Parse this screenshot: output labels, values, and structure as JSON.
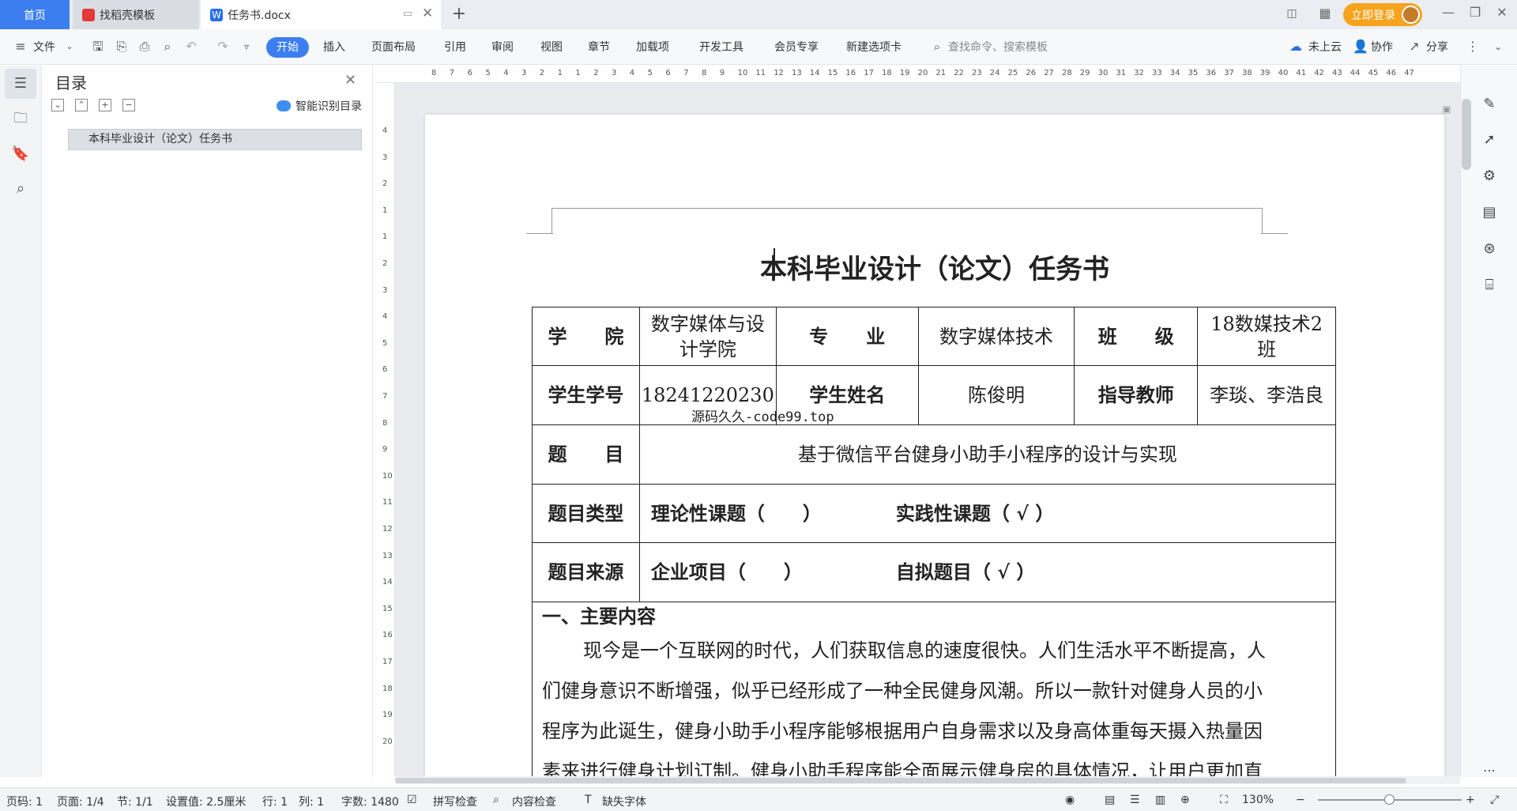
{
  "tabs": [
    {
      "label": "首页"
    },
    {
      "label": "找稻壳模板"
    },
    {
      "label": "任务书.docx"
    }
  ],
  "account": {
    "login_label": "立即登录"
  },
  "toolbar": {
    "file_label": "文件",
    "ribbon": [
      "开始",
      "插入",
      "页面布局",
      "引用",
      "审阅",
      "视图",
      "章节",
      "加载项",
      "开发工具",
      "会员专享",
      "新建选项卡"
    ],
    "search_placeholder": "查找命令、搜索模板",
    "cloud_label": "未上云",
    "collab_label": "协作",
    "share_label": "分享"
  },
  "toc": {
    "title": "目录",
    "ai_label": "智能识别目录",
    "items": [
      {
        "label": "本科毕业设计（论文）任务书"
      }
    ]
  },
  "ruler": {
    "h_ticks": [
      "8",
      "7",
      "6",
      "5",
      "4",
      "3",
      "2",
      "1",
      "1",
      "2",
      "3",
      "4",
      "5",
      "6",
      "7",
      "8",
      "9",
      "10",
      "11",
      "12",
      "13",
      "14",
      "15",
      "16",
      "17",
      "18",
      "19",
      "20",
      "21",
      "22",
      "23",
      "24",
      "25",
      "26",
      "27",
      "28",
      "29",
      "30",
      "31",
      "32",
      "33",
      "34",
      "35",
      "36",
      "37",
      "38",
      "39",
      "40",
      "41",
      "42",
      "43",
      "44",
      "45",
      "46",
      "47"
    ],
    "v_ticks": [
      "4",
      "3",
      "2",
      "1",
      "1",
      "2",
      "3",
      "4",
      "5",
      "6",
      "7",
      "8",
      "9",
      "10",
      "11",
      "12",
      "13",
      "14",
      "15",
      "16",
      "17",
      "18",
      "19",
      "20"
    ]
  },
  "document": {
    "title": "本科毕业设计（论文）任务书",
    "row1": {
      "college_label": "学　　院",
      "college_value": "数字媒体与设计学院",
      "major_label": "专　　业",
      "major_value": "数字媒体技术",
      "class_label": "班　　级",
      "class_value": "18数媒技术2班"
    },
    "row2": {
      "sid_label": "学生学号",
      "sid_value": "18241220230",
      "name_label": "学生姓名",
      "name_value": "陈俊明",
      "teacher_label": "指导教师",
      "teacher_value": "李琰、李浩良"
    },
    "topic_label": "题　　目",
    "topic_value": "基于微信平台健身小助手小程序的设计与实现",
    "type_label": "题目类型",
    "type_theory": "理论性课题（　　）",
    "type_practice": "实践性课题（ √ ）",
    "source_label": "题目来源",
    "source_enterprise": "企业项目（　　）",
    "source_self": "自拟题目（ √ ）",
    "section_heading": "一、主要内容",
    "paragraph_lines": [
      "现今是一个互联网的时代，人们获取信息的速度很快。人们生活水平不断提高，人",
      "们健身意识不断增强，似乎已经形成了一种全民健身风潮。所以一款针对健身人员的小",
      "程序为此诞生，健身小助手小程序能够根据用户自身需求以及身高体重每天摄入热量因",
      "素来进行健身计划订制。健身小助手程序能全面展示健身房的具体情况，让用户更加直"
    ],
    "watermark": "源码久久-code99.top"
  },
  "status": {
    "page": "页码: 1",
    "pages": "页面: 1/4",
    "section": "节: 1/1",
    "setting": "设置值: 2.5厘米",
    "row": "行: 1",
    "col": "列: 1",
    "words": "字数: 1480",
    "spell": "拼写检查",
    "content_check": "内容检查",
    "missing_font": "缺失字体",
    "zoom": "130%"
  }
}
